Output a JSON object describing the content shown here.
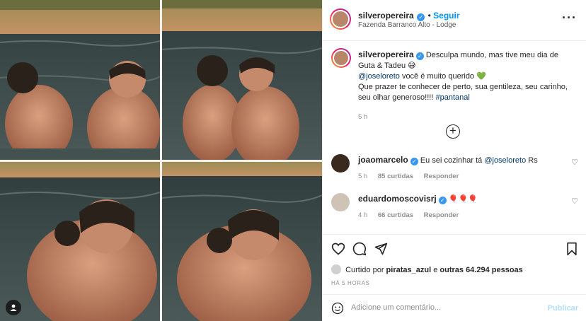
{
  "post": {
    "username": "silveropereira",
    "follow_label": "Seguir",
    "location": "Fazenda Barranco Alto - Lodge",
    "more_icon": "more-options-icon"
  },
  "caption": {
    "username": "silveropereira",
    "line1": "Desculpa mundo, mas tive meu dia de Guta & Tadeu 😅",
    "mention": "@joseloreto",
    "line2": "você é muito querido 💚",
    "line3": "Que prazer te conhecer de perto, sua gentileza, seu carinho, seu olhar generoso!!!!",
    "hashtag": "#pantanal",
    "time": "5 h"
  },
  "comments": [
    {
      "username": "joaomarcelo",
      "text": "Eu sei cozinhar tá",
      "mention": "@joseloreto",
      "suffix": "Rs",
      "time": "5 h",
      "likes": "85 curtidas",
      "reply": "Responder"
    },
    {
      "username": "eduardomoscovisrj",
      "text": "🎈🎈🎈",
      "time": "4 h",
      "likes": "66 curtidas",
      "reply": "Responder"
    }
  ],
  "actions": {
    "liked_prefix": "Curtido por",
    "liked_user": "piratas_azul",
    "liked_mid": "e",
    "liked_count": "outras 64.294 pessoas",
    "timestamp": "HÁ 5 HORAS"
  },
  "add_comment": {
    "placeholder": "Adicione um comentário...",
    "publish_label": "Publicar"
  },
  "colors": {
    "accent": "#0095f6",
    "verified": "#3897f0",
    "water": "#3b4a49",
    "sand": "#b58a57"
  }
}
